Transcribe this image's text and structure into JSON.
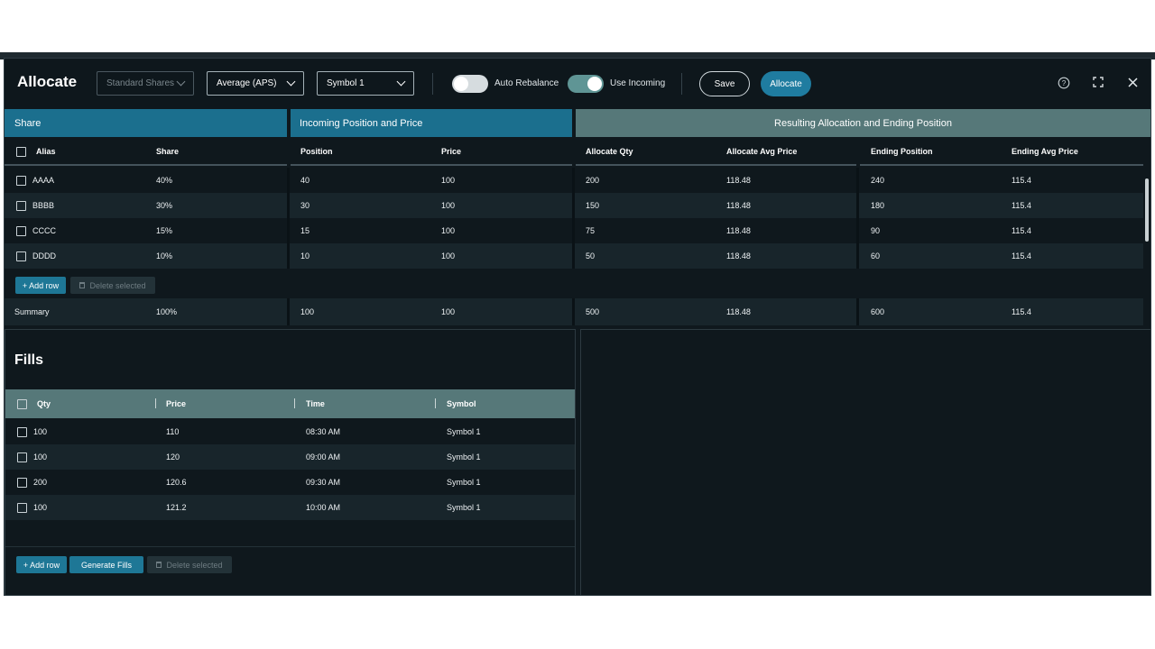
{
  "header": {
    "title": "Allocate",
    "share_mode": "Standard Shares",
    "price_mode": "Average (APS)",
    "symbol": "Symbol 1",
    "auto_rebalance_label": "Auto Rebalance",
    "auto_rebalance_on": false,
    "use_incoming_label": "Use Incoming",
    "use_incoming_on": true,
    "save_label": "Save",
    "allocate_label": "Allocate",
    "icons": [
      "help-icon",
      "expand-icon",
      "close-icon"
    ]
  },
  "allocation_table": {
    "groups": [
      "Share",
      "Incoming Position and Price",
      "Resulting Allocation and Ending Position"
    ],
    "columns": [
      "Alias",
      "Share",
      "Position",
      "Price",
      "Allocate Qty",
      "Allocate Avg Price",
      "Ending Position",
      "Ending Avg Price"
    ],
    "rows": [
      {
        "alias": "AAAA",
        "share": "40%",
        "position": "40",
        "price": "100",
        "alloc_qty": "200",
        "alloc_avg": "118.48",
        "end_pos": "240",
        "end_avg": "115.4"
      },
      {
        "alias": "BBBB",
        "share": "30%",
        "position": "30",
        "price": "100",
        "alloc_qty": "150",
        "alloc_avg": "118.48",
        "end_pos": "180",
        "end_avg": "115.4"
      },
      {
        "alias": "CCCC",
        "share": "15%",
        "position": "15",
        "price": "100",
        "alloc_qty": "75",
        "alloc_avg": "118.48",
        "end_pos": "90",
        "end_avg": "115.4"
      },
      {
        "alias": "DDDD",
        "share": "10%",
        "position": "10",
        "price": "100",
        "alloc_qty": "50",
        "alloc_avg": "118.48",
        "end_pos": "60",
        "end_avg": "115.4"
      }
    ],
    "add_row_label": "+ Add row",
    "delete_label": "Delete selected",
    "summary": {
      "label": "Summary",
      "share": "100%",
      "position": "100",
      "price": "100",
      "alloc_qty": "500",
      "alloc_avg": "118.48",
      "end_pos": "600",
      "end_avg": "115.4"
    }
  },
  "fills": {
    "title": "Fills",
    "columns": [
      "Qty",
      "Price",
      "Time",
      "Symbol"
    ],
    "rows": [
      {
        "qty": "100",
        "price": "110",
        "time": "08:30 AM",
        "symbol": "Symbol 1"
      },
      {
        "qty": "100",
        "price": "120",
        "time": "09:00 AM",
        "symbol": "Symbol 1"
      },
      {
        "qty": "200",
        "price": "120.6",
        "time": "09:30 AM",
        "symbol": "Symbol 1"
      },
      {
        "qty": "100",
        "price": "121.2",
        "time": "10:00 AM",
        "symbol": "Symbol 1"
      }
    ],
    "add_row_label": "+ Add row",
    "generate_label": "Generate Fills",
    "delete_label": "Delete selected"
  },
  "colors": {
    "background": "#0f181d",
    "row_alt": "#18252b",
    "accent_blue": "#1b6f8e",
    "accent_teal": "#567879",
    "button_blue": "#1f7ca0"
  }
}
